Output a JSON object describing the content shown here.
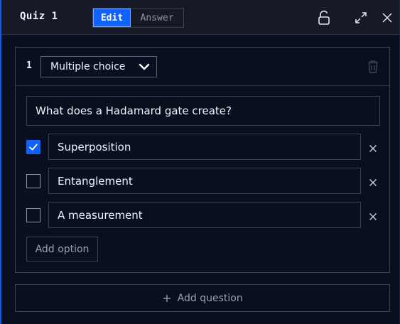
{
  "window": {
    "title": "Quiz 1",
    "mode_tabs": [
      {
        "label": "Edit",
        "active": true
      },
      {
        "label": "Answer",
        "active": false
      }
    ],
    "icons": [
      "unlock-icon",
      "expand-icon",
      "close-icon"
    ]
  },
  "question": {
    "number": "1",
    "type_selected": "Multiple choice",
    "text": "What does a Hadamard gate create?",
    "options": [
      {
        "text": "Superposition",
        "checked": true
      },
      {
        "text": "Entanglement",
        "checked": false
      },
      {
        "text": "A measurement",
        "checked": false
      }
    ],
    "add_option_label": "Add option"
  },
  "footer": {
    "add_question_label": "Add question"
  },
  "colors": {
    "accent": "#0f62fe",
    "background": "#0a0f1f",
    "titlebar": "#161a27",
    "border": "#3a4356"
  }
}
